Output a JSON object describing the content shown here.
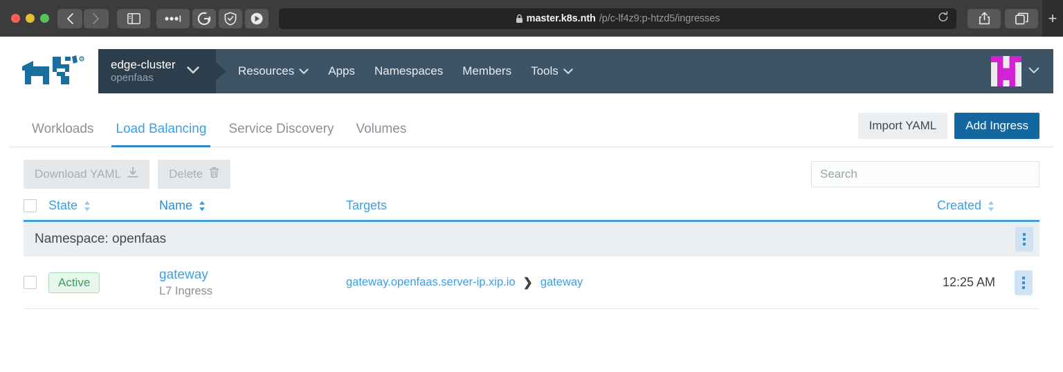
{
  "browser": {
    "url_host": "master.k8s.nth",
    "url_path": "/p/c-lf4z9:p-htzd5/ingresses",
    "lock_icon": "lock-icon",
    "reload_icon": "reload-icon",
    "back_icon": "back-chevron-icon",
    "forward_icon": "forward-chevron-icon",
    "sidebar_icon": "sidebar-toggle-icon",
    "extension_icons": [
      "onepassword-icon",
      "grammarly-icon",
      "shield-icon",
      "play-icon"
    ],
    "share_icon": "share-icon",
    "tabs_overview_icon": "tabs-overview-icon",
    "new_tab_label": "+"
  },
  "navbar": {
    "logo_name": "rancher-cow-logo",
    "cluster": "edge-cluster",
    "project": "openfaas",
    "cluster_caret": "chevron-down-icon",
    "links": [
      {
        "label": "Resources",
        "has_caret": true
      },
      {
        "label": "Apps",
        "has_caret": false
      },
      {
        "label": "Namespaces",
        "has_caret": false
      },
      {
        "label": "Members",
        "has_caret": false
      },
      {
        "label": "Tools",
        "has_caret": true
      }
    ],
    "avatar_name": "user-avatar-identicon",
    "avatar_colors": {
      "primary": "#d322d3",
      "secondary": "#ececec"
    },
    "avatar_caret": "chevron-down-icon"
  },
  "tabs": [
    {
      "label": "Workloads",
      "active": false
    },
    {
      "label": "Load Balancing",
      "active": true
    },
    {
      "label": "Service Discovery",
      "active": false
    },
    {
      "label": "Volumes",
      "active": false
    }
  ],
  "header_actions": {
    "import_yaml": "Import YAML",
    "add_ingress": "Add Ingress"
  },
  "toolbar": {
    "download_yaml": "Download YAML",
    "download_icon": "download-icon",
    "delete": "Delete",
    "delete_icon": "trash-icon",
    "search_placeholder": "Search",
    "search_value": ""
  },
  "table": {
    "columns": [
      {
        "key": "state",
        "label": "State",
        "sortable": true
      },
      {
        "key": "name",
        "label": "Name",
        "sortable": true
      },
      {
        "key": "targets",
        "label": "Targets",
        "sortable": false
      },
      {
        "key": "created",
        "label": "Created",
        "sortable": true
      }
    ],
    "group": {
      "label": "Namespace: openfaas"
    },
    "rows": [
      {
        "state": "Active",
        "name": "gateway",
        "subtype": "L7 Ingress",
        "target_host": "gateway.openfaas.server-ip.xip.io",
        "target_sep": "❯",
        "target_service": "gateway",
        "created": "12:25 AM"
      }
    ],
    "row_menu_icon": "kebab-menu-icon"
  },
  "colors": {
    "accent_blue": "#3aa0e4",
    "primary_button": "#1267a0",
    "navbar_bg": "#3d5466",
    "cluster_chip_bg": "#2c3e4c",
    "badge_green": "#3a9d58",
    "logo_blue": "#1a6f9e"
  }
}
